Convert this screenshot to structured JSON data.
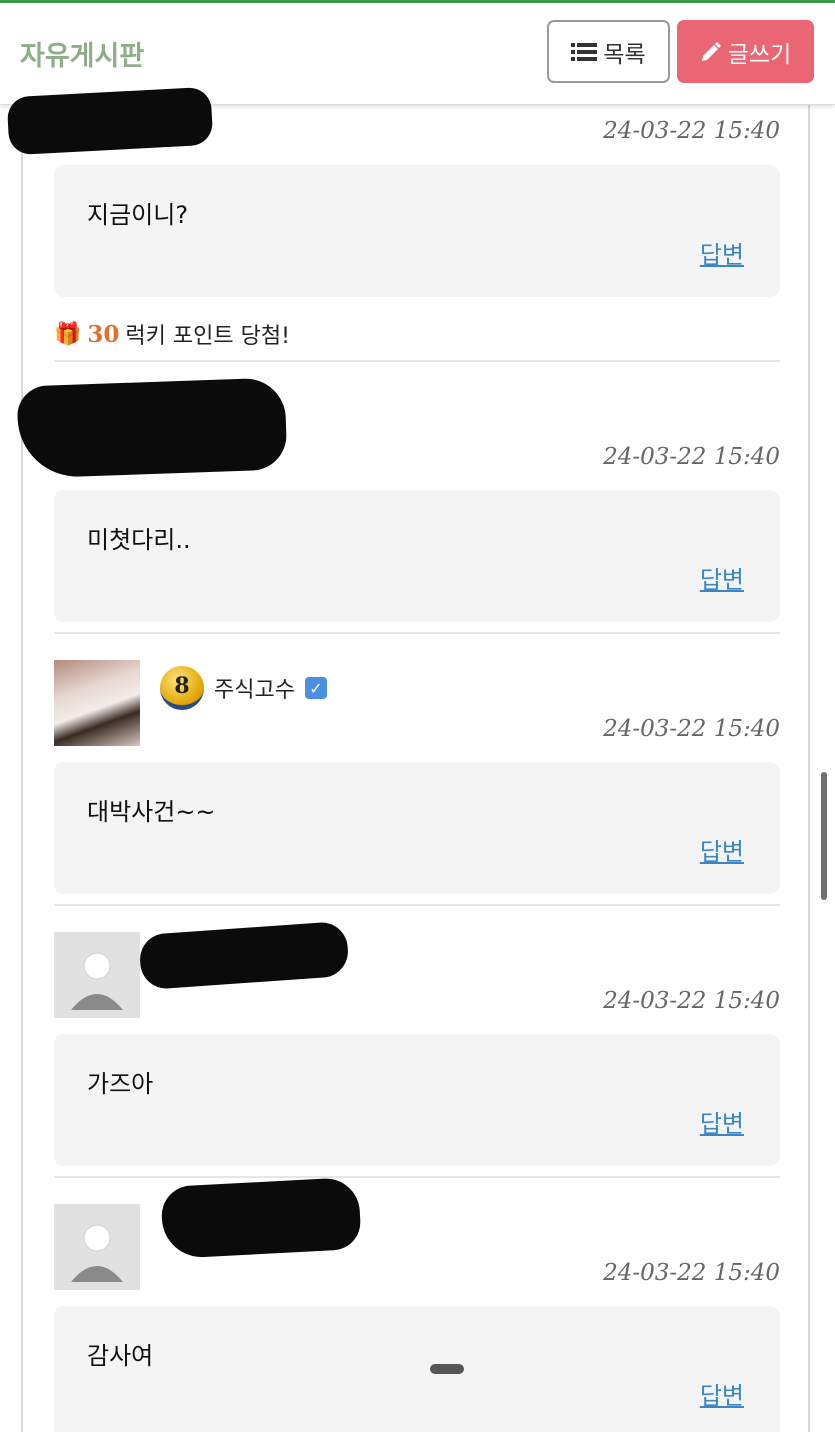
{
  "header": {
    "title": "자유게시판",
    "list_button": "목록",
    "write_button": "글쓰기"
  },
  "lucky": {
    "points": "30",
    "text": "럭키 포인트 당첨!"
  },
  "comments": [
    {
      "author": "",
      "date": "24-03-22 15:40",
      "text": "지금이니?",
      "reply": "답변"
    },
    {
      "author": "",
      "date": "24-03-22 15:40",
      "text": "미쳣다리..",
      "reply": "답변"
    },
    {
      "author": "주식고수",
      "level": "8",
      "date": "24-03-22 15:40",
      "text": "대박사건~~",
      "reply": "답변"
    },
    {
      "author": "",
      "date": "24-03-22 15:40",
      "text": "가즈아",
      "reply": "답변"
    },
    {
      "author": "",
      "date": "24-03-22 15:40",
      "text": "감사여",
      "reply": "답변"
    }
  ],
  "colors": {
    "accent_green": "#3f9a4f",
    "title_green": "#8fae88",
    "write_button": "#ea6674",
    "link_blue": "#3b86c4"
  }
}
